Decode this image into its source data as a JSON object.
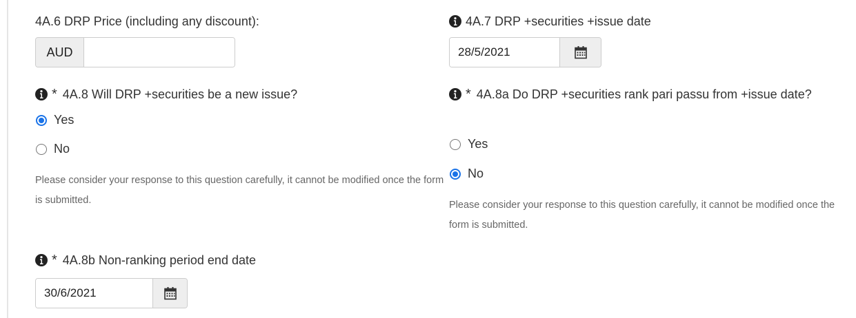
{
  "drp_price": {
    "label": "4A.6 DRP Price (including any discount):",
    "currency": "AUD",
    "value": ""
  },
  "issue_date": {
    "label": "4A.7 DRP +securities +issue date",
    "value": "28/5/2021",
    "icon": "calendar-icon"
  },
  "new_issue": {
    "label": "4A.8 Will DRP +securities be a new issue?",
    "required_mark": "*",
    "options": [
      {
        "label": "Yes",
        "selected": true
      },
      {
        "label": "No",
        "selected": false
      }
    ],
    "help": "Please consider your response to this question carefully, it cannot be modified once the form is submitted."
  },
  "pari_passu": {
    "label": "4A.8a Do DRP +securities rank pari passu from +issue date?",
    "required_mark": "*",
    "options": [
      {
        "label": "Yes",
        "selected": false
      },
      {
        "label": "No",
        "selected": true
      }
    ],
    "help": "Please consider your response to this question carefully, it cannot be modified once the form is submitted."
  },
  "non_ranking": {
    "label": "4A.8b Non-ranking period end date",
    "required_mark": "*",
    "value": "30/6/2021",
    "icon": "calendar-icon"
  },
  "colors": {
    "accent": "#1a73e8",
    "text": "#333333",
    "help_text": "#666666",
    "addon_bg": "#eeeeee",
    "border": "#cccccc"
  }
}
